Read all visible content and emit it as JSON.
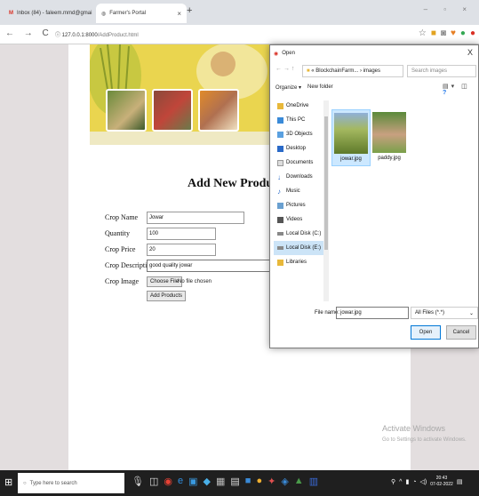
{
  "browser": {
    "tabs": [
      {
        "label": "Inbox (84) - faleem.mmd@gmai",
        "close": "×"
      },
      {
        "label": "Farmer's Portal",
        "close": "×"
      }
    ],
    "new_tab": "+",
    "window_controls": "– ▫ ×",
    "nav_glyphs": "← → C",
    "url_host": "127.0.0.1:8000",
    "url_path": "/AddProduct.html"
  },
  "page": {
    "heading": "Add New Product",
    "form": {
      "crop_name_label": "Crop Name",
      "crop_name_value": "Jowar",
      "quantity_label": "Quantity",
      "quantity_value": "100",
      "price_label": "Crop Price",
      "price_value": "20",
      "description_label": "Crop Description",
      "description_value": "good quality jowar",
      "image_label": "Crop Image",
      "choose_file_label": "Choose File",
      "no_file_text": "No file chosen",
      "submit_label": "Add Products"
    }
  },
  "dialog": {
    "title": "Open",
    "close": "X",
    "path": "« BlockchainFarm... › images",
    "search_placeholder": "Search images",
    "organize": "Organize ▾",
    "new_folder": "New folder",
    "nav_items": [
      {
        "label": "OneDrive",
        "icon": "folder-icon"
      },
      {
        "label": "This PC",
        "icon": "computer-icon"
      },
      {
        "label": "3D Objects",
        "icon": "cube-icon"
      },
      {
        "label": "Desktop",
        "icon": "desktop-icon"
      },
      {
        "label": "Documents",
        "icon": "document-icon"
      },
      {
        "label": "Downloads",
        "icon": "download-icon"
      },
      {
        "label": "Music",
        "icon": "music-icon"
      },
      {
        "label": "Pictures",
        "icon": "picture-icon"
      },
      {
        "label": "Videos",
        "icon": "video-icon"
      },
      {
        "label": "Local Disk (C:)",
        "icon": "drive-icon"
      },
      {
        "label": "Local Disk (E:)",
        "icon": "drive-icon"
      },
      {
        "label": "Libraries",
        "icon": "library-icon"
      }
    ],
    "files": [
      {
        "name": "jowar.jpg"
      },
      {
        "name": "paddy.jpg"
      }
    ],
    "filename_label": "File name:",
    "filename_value": "jowar.jpg",
    "filetype_value": "All Files (*.*)",
    "open_label": "Open",
    "cancel_label": "Cancel"
  },
  "watermark": {
    "line1": "Activate Windows",
    "line2": "Go to Settings to activate Windows."
  },
  "taskbar": {
    "search_placeholder": "Type here to search",
    "time": "20:43",
    "date": "07-02-2022"
  }
}
